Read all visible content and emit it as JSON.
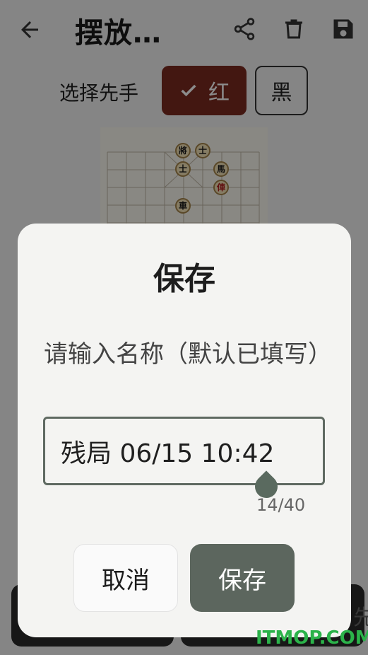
{
  "header": {
    "title": "摆放…"
  },
  "first_player": {
    "label": "选择先手",
    "options": [
      "红",
      "黑"
    ],
    "selected": "红"
  },
  "board": {
    "pieces": [
      {
        "char": "將",
        "side": "black"
      },
      {
        "char": "士",
        "side": "black"
      },
      {
        "char": "士",
        "side": "black"
      },
      {
        "char": "馬",
        "side": "black"
      },
      {
        "char": "俥",
        "side": "red"
      },
      {
        "char": "車",
        "side": "black"
      }
    ]
  },
  "dialog": {
    "title": "保存",
    "prompt": "请输入名称（默认已填写）",
    "input_value": "残局 06/15 10:42",
    "counter": "14/40",
    "cancel_label": "取消",
    "save_label": "保存"
  },
  "bottom_partial_text": "先",
  "watermark": "ITMOP.COM",
  "colors": {
    "accent_red": "#7a2b20",
    "dialog_button": "#5c665e",
    "watermark": "#2bb34a"
  }
}
